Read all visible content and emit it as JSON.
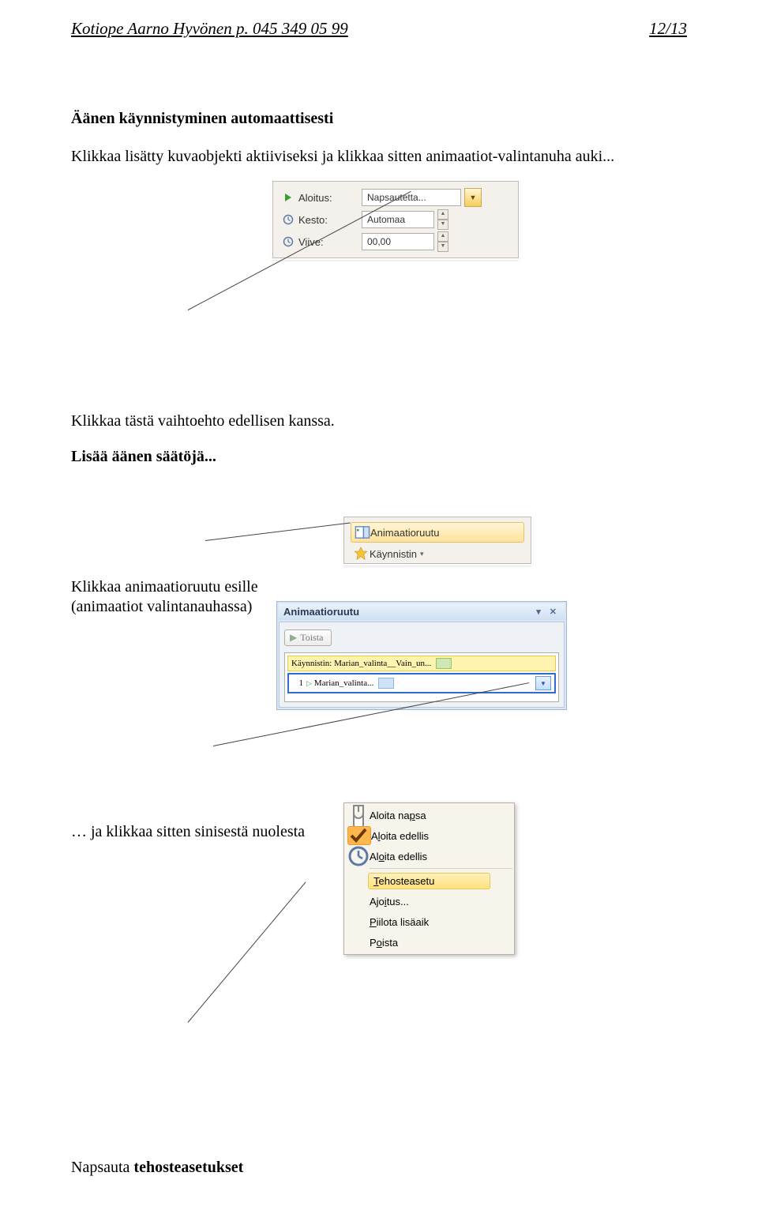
{
  "header": {
    "left": "Kotiope Aarno Hyvönen  p. 045 349 05 99",
    "right": "12/13"
  },
  "heading": "Äänen käynnistyminen automaattisesti",
  "para1": "Klikkaa lisätty kuvaobjekti aktiiviseksi ja klikkaa sitten animaatiot-valintanuha auki...",
  "shot1": {
    "rows": [
      {
        "label": "Aloitus:",
        "value": "Napsautetta..."
      },
      {
        "label": "Kesto:",
        "value": "Automaa"
      },
      {
        "label": "Viive:",
        "value": "00,00"
      }
    ]
  },
  "para2": "Klikkaa tästä vaihtoehto edellisen kanssa.",
  "heading2": "Lisää äänen säätöjä...",
  "shot2": {
    "item1": "Animaatioruutu",
    "item2": "Käynnistin"
  },
  "para3a": "Klikkaa animaatioruutu esille",
  "para3b": "(animaatiot valintanauhassa)",
  "shot3": {
    "title": "Animaatioruutu",
    "play": "Toista",
    "item1": "Käynnistin: Marian_valinta__Vain_un...",
    "item2_num": "1",
    "item2": "Marian_valinta..."
  },
  "para4": "… ja klikkaa sitten sinisestä nuolesta",
  "shot4": {
    "items": [
      {
        "key": "m1",
        "html": "Aloita na<u>p</u>sa"
      },
      {
        "key": "m2",
        "html": "A<u>l</u>oita edellis"
      },
      {
        "key": "m3",
        "html": "Al<u>o</u>ita edellis"
      },
      {
        "key": "m4",
        "html": "<u>T</u>ehosteasetu"
      },
      {
        "key": "m5",
        "html": "Ajo<u>i</u>tus..."
      },
      {
        "key": "m6",
        "html": "<u>P</u>iilota lisäaik"
      },
      {
        "key": "m7",
        "html": "P<u>o</u>ista"
      }
    ]
  },
  "footer_pre": "Napsauta ",
  "footer_bold": "tehosteasetukset"
}
